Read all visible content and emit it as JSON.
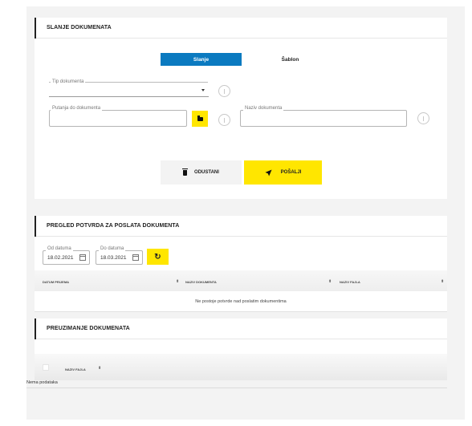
{
  "section_send": {
    "title": "SLANJE DOKUMENATA",
    "tabs": [
      {
        "label": "Slanje",
        "active": true
      },
      {
        "label": "Šablon",
        "active": false
      }
    ],
    "doc_type": {
      "label": "Tip dokumenta",
      "value": ""
    },
    "doc_path": {
      "label": "Putanja do dokumenta",
      "value": ""
    },
    "doc_name": {
      "label": "Naziv dokumenta",
      "value": ""
    },
    "cancel_label": "ODUSTANI",
    "send_label": "POŠALJI"
  },
  "section_receipts": {
    "title": "PREGLED POTVRDA ZA POSLATA DOKUMENTA",
    "date_from": {
      "label": "Od datuma",
      "value": "18.02.2021"
    },
    "date_to": {
      "label": "Do datuma",
      "value": "18.03.2021"
    },
    "columns": [
      "DATUM PRIJEMA",
      "NAZIV DOKUMENTA",
      "NAZIV FAJLA"
    ],
    "empty_text": "Ne postoje potvrde nad poslatim dokumentima"
  },
  "section_download": {
    "title": "PREUZIMANJE DOKUMENATA",
    "columns": [
      "NAZIV FAJLA"
    ],
    "empty_text": "Nema podataka"
  },
  "colors": {
    "accent_blue": "#0b7ac0",
    "accent_yellow": "#ffe600"
  }
}
